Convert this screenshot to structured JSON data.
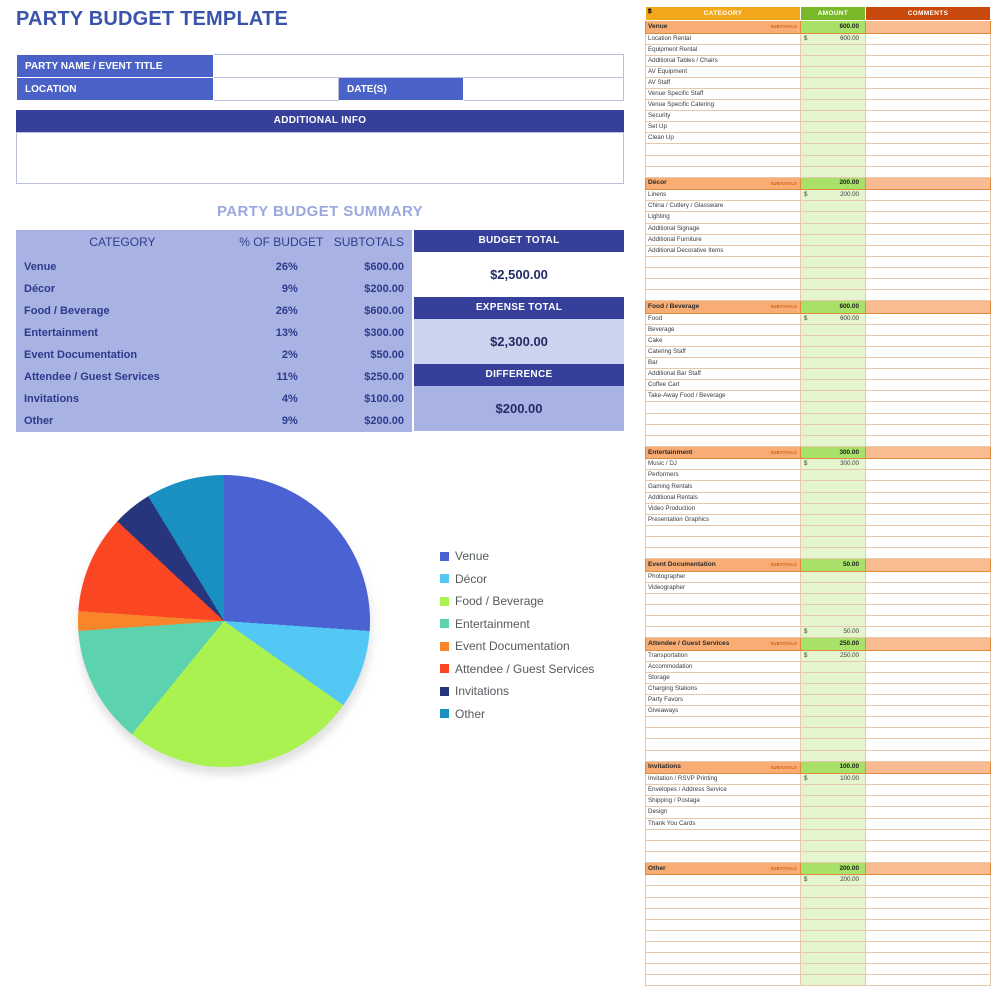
{
  "document": {
    "title": "PARTY BUDGET TEMPLATE"
  },
  "info_form": {
    "party_name_label": "PARTY NAME / EVENT TITLE",
    "party_name_value": "",
    "location_label": "LOCATION",
    "location_value": "",
    "dates_label": "DATE(S)",
    "dates_value": "",
    "additional_info_label": "ADDITIONAL INFO",
    "additional_info_value": ""
  },
  "summary": {
    "title": "PARTY BUDGET SUMMARY",
    "headers": {
      "category": "CATEGORY",
      "percent": "% OF BUDGET",
      "subtotals": "SUBTOTALS"
    },
    "rows": [
      {
        "category": "Venue",
        "percent": "26%",
        "subtotal": "$600.00"
      },
      {
        "category": "Décor",
        "percent": "9%",
        "subtotal": "$200.00"
      },
      {
        "category": "Food / Beverage",
        "percent": "26%",
        "subtotal": "$600.00"
      },
      {
        "category": "Entertainment",
        "percent": "13%",
        "subtotal": "$300.00"
      },
      {
        "category": "Event Documentation",
        "percent": "2%",
        "subtotal": "$50.00"
      },
      {
        "category": "Attendee / Guest Services",
        "percent": "11%",
        "subtotal": "$250.00"
      },
      {
        "category": "Invitations",
        "percent": "4%",
        "subtotal": "$100.00"
      },
      {
        "category": "Other",
        "percent": "9%",
        "subtotal": "$200.00"
      }
    ],
    "totals": {
      "budget_total_label": "BUDGET TOTAL",
      "budget_total_value": "$2,500.00",
      "expense_total_label": "EXPENSE TOTAL",
      "expense_total_value": "$2,300.00",
      "difference_label": "DIFFERENCE",
      "difference_value": "$200.00"
    }
  },
  "chart_data": {
    "type": "pie",
    "title": "",
    "legend_position": "right",
    "categories": [
      "Venue",
      "Décor",
      "Food / Beverage",
      "Entertainment",
      "Event Documentation",
      "Attendee / Guest Services",
      "Invitations",
      "Other"
    ],
    "values": [
      600,
      200,
      600,
      300,
      50,
      250,
      100,
      200
    ],
    "percentages": [
      26,
      9,
      26,
      13,
      2,
      11,
      4,
      9
    ],
    "colors": [
      "#4a62d2",
      "#53c8f5",
      "#a9f250",
      "#5cd3ae",
      "#f9852a",
      "#fb4624",
      "#27357c",
      "#1a8fc1"
    ],
    "total": 2300
  },
  "budget_sheet": {
    "headers": {
      "category": "CATEGORY",
      "amount": "AMOUNT",
      "comments": "COMMENTS"
    },
    "subtotal_tag": "SUBTOTALS",
    "currency_symbol": "$",
    "sections": [
      {
        "name": "Venue",
        "subtotal": "600.00",
        "items": [
          {
            "label": "Location Rental",
            "amount": "600.00"
          },
          {
            "label": "Equipment Rental",
            "amount": ""
          },
          {
            "label": "Additional Tables / Chairs",
            "amount": ""
          },
          {
            "label": "AV Equipment",
            "amount": ""
          },
          {
            "label": "AV Staff",
            "amount": ""
          },
          {
            "label": "Venue Specific Staff",
            "amount": ""
          },
          {
            "label": "Venue Specific Catering",
            "amount": ""
          },
          {
            "label": "Security",
            "amount": ""
          },
          {
            "label": "Set Up",
            "amount": ""
          },
          {
            "label": "Clean Up",
            "amount": ""
          },
          {
            "label": "",
            "amount": ""
          },
          {
            "label": "",
            "amount": ""
          },
          {
            "label": "",
            "amount": ""
          }
        ]
      },
      {
        "name": "Décor",
        "subtotal": "200.00",
        "items": [
          {
            "label": "Linens",
            "amount": "200.00"
          },
          {
            "label": "China / Cutlery / Glassware",
            "amount": ""
          },
          {
            "label": "Lighting",
            "amount": ""
          },
          {
            "label": "Additional Signage",
            "amount": ""
          },
          {
            "label": "Additional Furniture",
            "amount": ""
          },
          {
            "label": "Additional Decorative Items",
            "amount": ""
          },
          {
            "label": "",
            "amount": ""
          },
          {
            "label": "",
            "amount": ""
          },
          {
            "label": "",
            "amount": ""
          },
          {
            "label": "",
            "amount": ""
          }
        ]
      },
      {
        "name": "Food / Beverage",
        "subtotal": "600.00",
        "items": [
          {
            "label": "Food",
            "amount": "600.00"
          },
          {
            "label": "Beverage",
            "amount": ""
          },
          {
            "label": "Cake",
            "amount": ""
          },
          {
            "label": "Catering Staff",
            "amount": ""
          },
          {
            "label": "Bar",
            "amount": ""
          },
          {
            "label": "Additional Bar Staff",
            "amount": ""
          },
          {
            "label": "Coffee Cart",
            "amount": ""
          },
          {
            "label": "Take-Away Food / Beverage",
            "amount": ""
          },
          {
            "label": "",
            "amount": ""
          },
          {
            "label": "",
            "amount": ""
          },
          {
            "label": "",
            "amount": ""
          },
          {
            "label": "",
            "amount": ""
          }
        ]
      },
      {
        "name": "Entertainment",
        "subtotal": "300.00",
        "items": [
          {
            "label": "Music / DJ",
            "amount": "300.00"
          },
          {
            "label": "Performers",
            "amount": ""
          },
          {
            "label": "Gaming Rentals",
            "amount": ""
          },
          {
            "label": "Additional Rentals",
            "amount": ""
          },
          {
            "label": "Video Production",
            "amount": ""
          },
          {
            "label": "Presentation Graphics",
            "amount": ""
          },
          {
            "label": "",
            "amount": ""
          },
          {
            "label": "",
            "amount": ""
          },
          {
            "label": "",
            "amount": ""
          }
        ]
      },
      {
        "name": "Event Documentation",
        "subtotal": "50.00",
        "items": [
          {
            "label": "Photographer",
            "amount": ""
          },
          {
            "label": "Videographer",
            "amount": ""
          },
          {
            "label": "",
            "amount": ""
          },
          {
            "label": "",
            "amount": ""
          },
          {
            "label": "",
            "amount": ""
          },
          {
            "label": "",
            "amount": "50.00"
          }
        ]
      },
      {
        "name": "Attendee / Guest Services",
        "subtotal": "250.00",
        "items": [
          {
            "label": "Transportation",
            "amount": "250.00"
          },
          {
            "label": "Accommodation",
            "amount": ""
          },
          {
            "label": "Storage",
            "amount": ""
          },
          {
            "label": "Charging Stations",
            "amount": ""
          },
          {
            "label": "Party Favors",
            "amount": ""
          },
          {
            "label": "Giveaways",
            "amount": ""
          },
          {
            "label": "",
            "amount": ""
          },
          {
            "label": "",
            "amount": ""
          },
          {
            "label": "",
            "amount": ""
          },
          {
            "label": "",
            "amount": ""
          }
        ]
      },
      {
        "name": "Invitations",
        "subtotal": "100.00",
        "items": [
          {
            "label": "Invitation / RSVP Printing",
            "amount": "100.00"
          },
          {
            "label": "Envelopes / Address Service",
            "amount": ""
          },
          {
            "label": "Shipping / Postage",
            "amount": ""
          },
          {
            "label": "Design",
            "amount": ""
          },
          {
            "label": "Thank You Cards",
            "amount": ""
          },
          {
            "label": "",
            "amount": ""
          },
          {
            "label": "",
            "amount": ""
          },
          {
            "label": "",
            "amount": ""
          }
        ]
      },
      {
        "name": "Other",
        "subtotal": "200.00",
        "items": [
          {
            "label": "",
            "amount": "200.00"
          },
          {
            "label": "",
            "amount": ""
          },
          {
            "label": "",
            "amount": ""
          },
          {
            "label": "",
            "amount": ""
          },
          {
            "label": "",
            "amount": ""
          },
          {
            "label": "",
            "amount": ""
          },
          {
            "label": "",
            "amount": ""
          },
          {
            "label": "",
            "amount": ""
          },
          {
            "label": "",
            "amount": ""
          },
          {
            "label": "",
            "amount": ""
          }
        ]
      }
    ]
  }
}
